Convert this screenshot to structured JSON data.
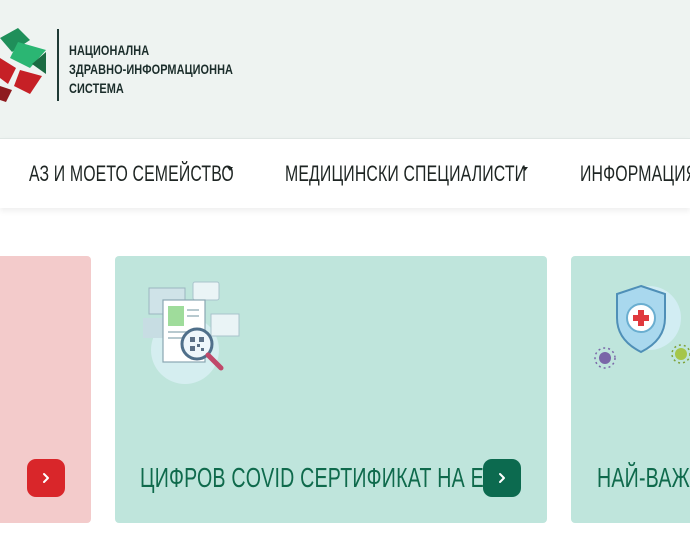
{
  "header": {
    "logo_lines": [
      "НАЦИОНАЛНА",
      "ЗДРАВНО-ИНФОРМАЦИОННА",
      "СИСТЕМА"
    ]
  },
  "nav": {
    "items": [
      {
        "label": "АЗ И МОЕТО СЕМЕЙСТВО",
        "has_dropdown": true
      },
      {
        "label": "МЕДИЦИНСКИ СПЕЦИАЛИСТИ",
        "has_dropdown": true
      },
      {
        "label": "ИНФОРМАЦИЯ",
        "has_dropdown": false
      }
    ]
  },
  "cards": [
    {
      "title": "",
      "color": "#f3cbcb",
      "button_color": "#d9262a",
      "icon": "chevron-right-icon"
    },
    {
      "title": "ЦИФРОВ COVID СЕРТИФИКАТ НА ЕС",
      "color": "#bfe5dc",
      "button_color": "#0c6a4f",
      "icon": "certificate-qr-illustration"
    },
    {
      "title": "НАЙ-ВАЖ",
      "color": "#bfe5dc",
      "icon": "shield-virus-illustration"
    }
  ],
  "colors": {
    "header_bg": "#eef3f1",
    "accent_green": "#0f6a4c",
    "accent_red": "#d9262a"
  }
}
